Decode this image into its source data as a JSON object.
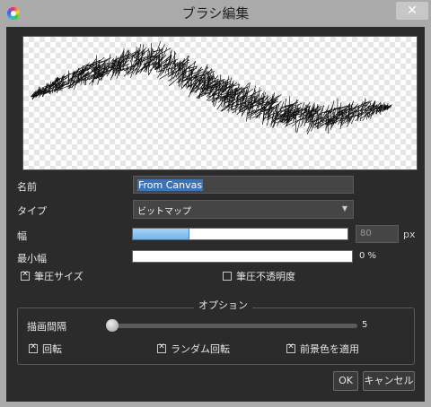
{
  "window": {
    "title": "ブラシ編集",
    "close_glyph": "✕"
  },
  "form": {
    "name_label": "名前",
    "name_value": "From Canvas",
    "type_label": "タイプ",
    "type_value": "ビットマップ",
    "width_label": "幅",
    "width_value": "80",
    "width_fraction": 0.26,
    "width_unit": "px",
    "min_width_label": "最小幅",
    "min_width_value": "0 %",
    "pen_pressure_size_label": "筆圧サイズ",
    "pen_pressure_size_checked": true,
    "pen_pressure_opacity_label": "筆圧不透明度",
    "pen_pressure_opacity_checked": false
  },
  "options": {
    "group_title": "オプション",
    "interval_label": "描画間隔",
    "interval_value": "5",
    "rotation_label": "回転",
    "rotation_checked": true,
    "random_rotation_label": "ランダム回転",
    "random_rotation_checked": true,
    "apply_fg_color_label": "前景色を適用",
    "apply_fg_color_checked": true
  },
  "buttons": {
    "ok_label": "OK",
    "cancel_label": "キャンセル"
  },
  "icons": {
    "app": "color-wheel-icon",
    "close": "close-icon",
    "dropdown": "chevron-down-icon",
    "check": "checkbox-check-icon"
  },
  "colors": {
    "background": "#2b2b2b",
    "slider_fill": "#8cc4f0",
    "selection": "#3d74b8",
    "titlebar": "#aaaaaa"
  }
}
